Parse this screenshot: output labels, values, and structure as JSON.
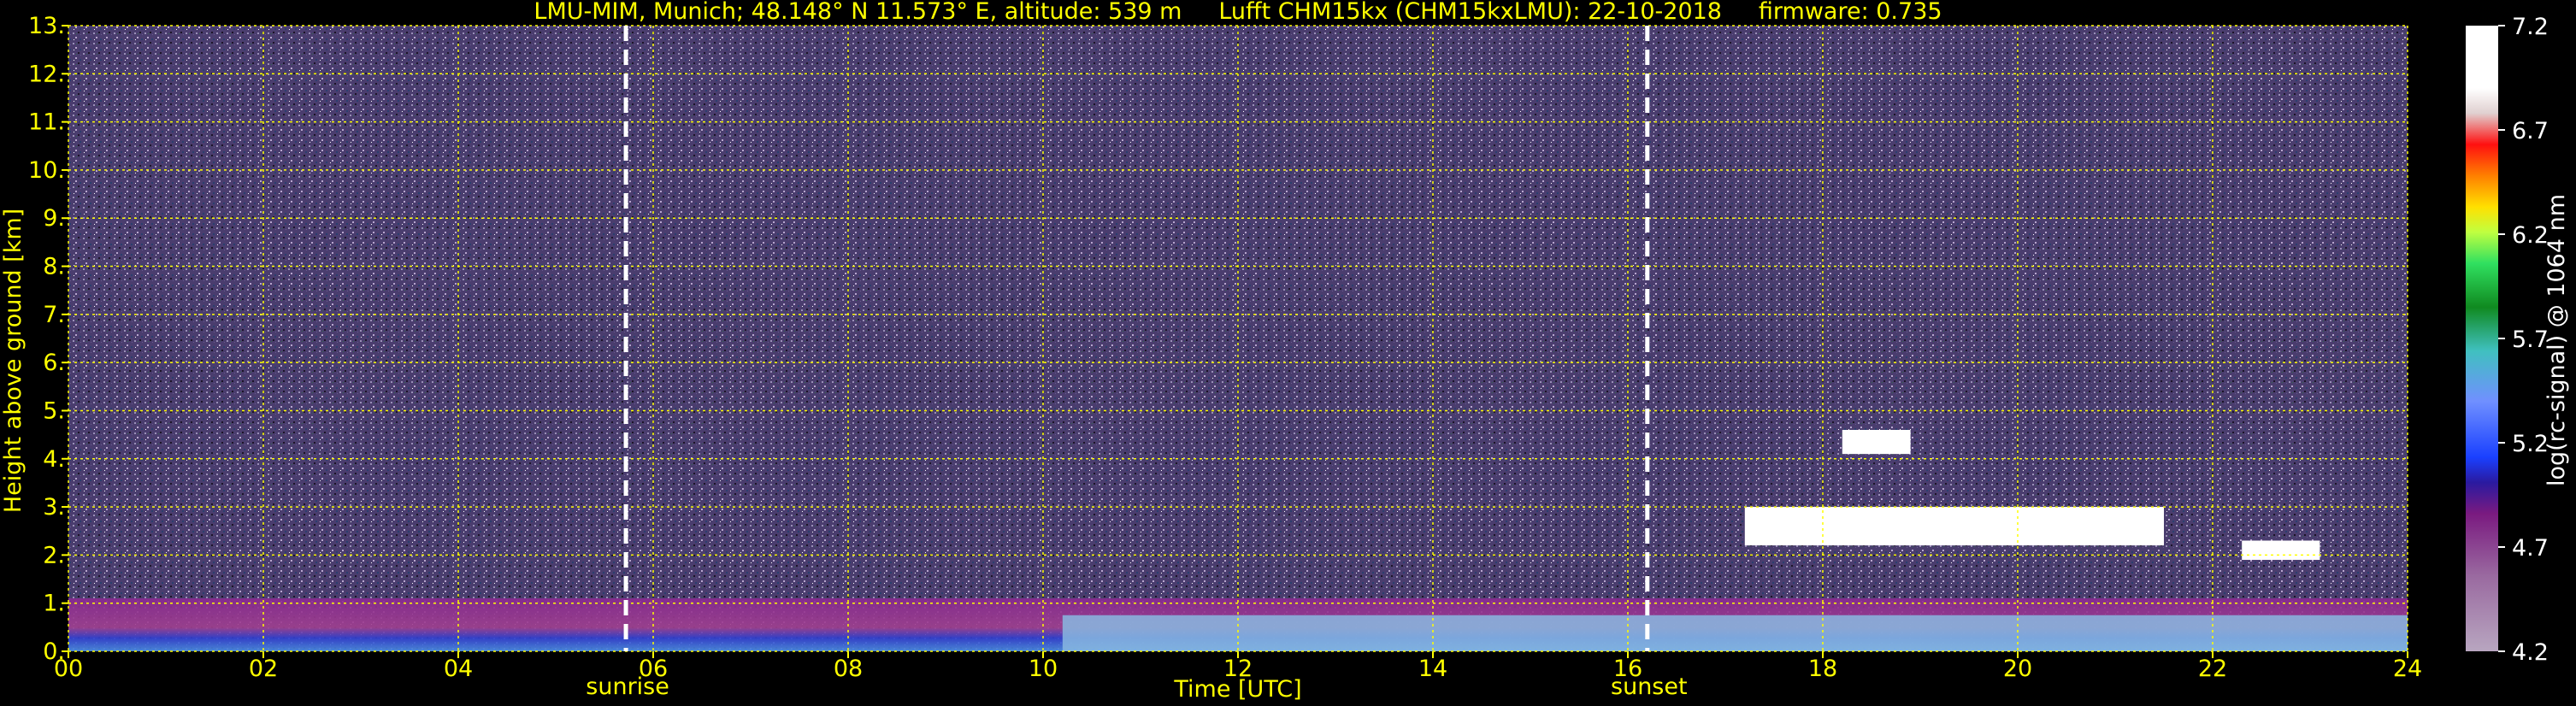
{
  "chart_data": {
    "type": "heatmap",
    "title": "LMU-MIM, Munich; 48.148° N 11.573° E, altitude: 539 m     Lufft CHM15kx (CHM15kxLMU): 22-10-2018     firmware: 0.735",
    "xlabel": "Time [UTC]",
    "ylabel": "Height above ground [km]",
    "xlim": [
      0,
      24
    ],
    "ylim": [
      0,
      13
    ],
    "x_ticks": [
      "00",
      "02",
      "04",
      "06",
      "08",
      "10",
      "12",
      "14",
      "16",
      "18",
      "20",
      "22",
      "24"
    ],
    "y_ticks": [
      "0.",
      "1.",
      "2.",
      "3.",
      "4.",
      "5.",
      "6.",
      "7.",
      "8.",
      "9.",
      "10.",
      "11.",
      "12.",
      "13."
    ],
    "grid": true,
    "colorbar": {
      "label": "log(rc-signal) @ 1064 nm",
      "range": [
        4.2,
        7.2
      ],
      "ticks": [
        "4.2",
        "4.7",
        "5.2",
        "5.7",
        "6.2",
        "6.7",
        "7.2"
      ]
    },
    "annotations": [
      {
        "text": "sunrise",
        "x": 5.72
      },
      {
        "text": "sunset",
        "x": 16.2
      }
    ],
    "features": [
      {
        "description": "boundary layer aerosol",
        "x_range": [
          0,
          24
        ],
        "height_km": [
          0,
          1.1
        ]
      },
      {
        "description": "cloud layer",
        "x_range": [
          17.2,
          21.5
        ],
        "height_km": [
          2.2,
          3.0
        ]
      },
      {
        "description": "cloud patch",
        "x_range": [
          18.2,
          18.9
        ],
        "height_km": [
          4.1,
          4.6
        ]
      },
      {
        "description": "low cloud",
        "x_range": [
          22.3,
          23.1
        ],
        "height_km": [
          1.9,
          2.3
        ]
      }
    ]
  },
  "colors": {
    "axis_text": "#ffff00",
    "grid": "#ffff00",
    "background_noise": "#4a3d6e",
    "sun_lines": "#ffffff"
  }
}
